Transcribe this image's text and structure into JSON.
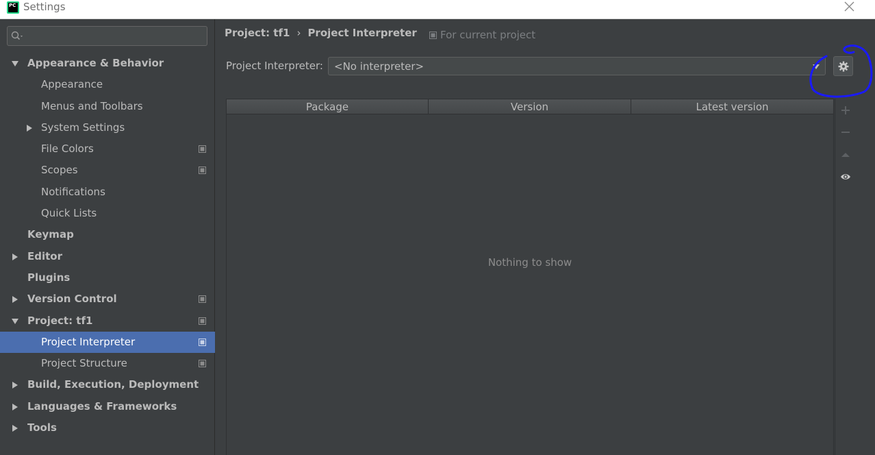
{
  "window": {
    "logo_text": "PC",
    "title": "Settings"
  },
  "sidebar": {
    "search": {
      "value": "",
      "placeholder": ""
    },
    "items": [
      {
        "label": "Appearance & Behavior"
      },
      {
        "label": "Appearance"
      },
      {
        "label": "Menus and Toolbars"
      },
      {
        "label": "System Settings"
      },
      {
        "label": "File Colors"
      },
      {
        "label": "Scopes"
      },
      {
        "label": "Notifications"
      },
      {
        "label": "Quick Lists"
      },
      {
        "label": "Keymap"
      },
      {
        "label": "Editor"
      },
      {
        "label": "Plugins"
      },
      {
        "label": "Version Control"
      },
      {
        "label": "Project: tf1"
      },
      {
        "label": "Project Interpreter"
      },
      {
        "label": "Project Structure"
      },
      {
        "label": "Build, Execution, Deployment"
      },
      {
        "label": "Languages & Frameworks"
      },
      {
        "label": "Tools"
      }
    ]
  },
  "main": {
    "breadcrumb": {
      "parent": "Project: tf1",
      "separator": "›",
      "current": "Project Interpreter"
    },
    "scope_note": "For current project",
    "interpreter": {
      "label": "Project Interpreter:",
      "value": "<No interpreter>"
    },
    "table": {
      "columns": [
        "Package",
        "Version",
        "Latest version"
      ],
      "empty_text": "Nothing to show"
    },
    "toolbar_icons": [
      "add-icon",
      "remove-icon",
      "upgrade-icon",
      "eye-icon"
    ]
  },
  "colors": {
    "background": "#3c3f41",
    "selection": "#4b6eaf",
    "text": "#bbbbbb",
    "annotation": "#1a1aff"
  }
}
